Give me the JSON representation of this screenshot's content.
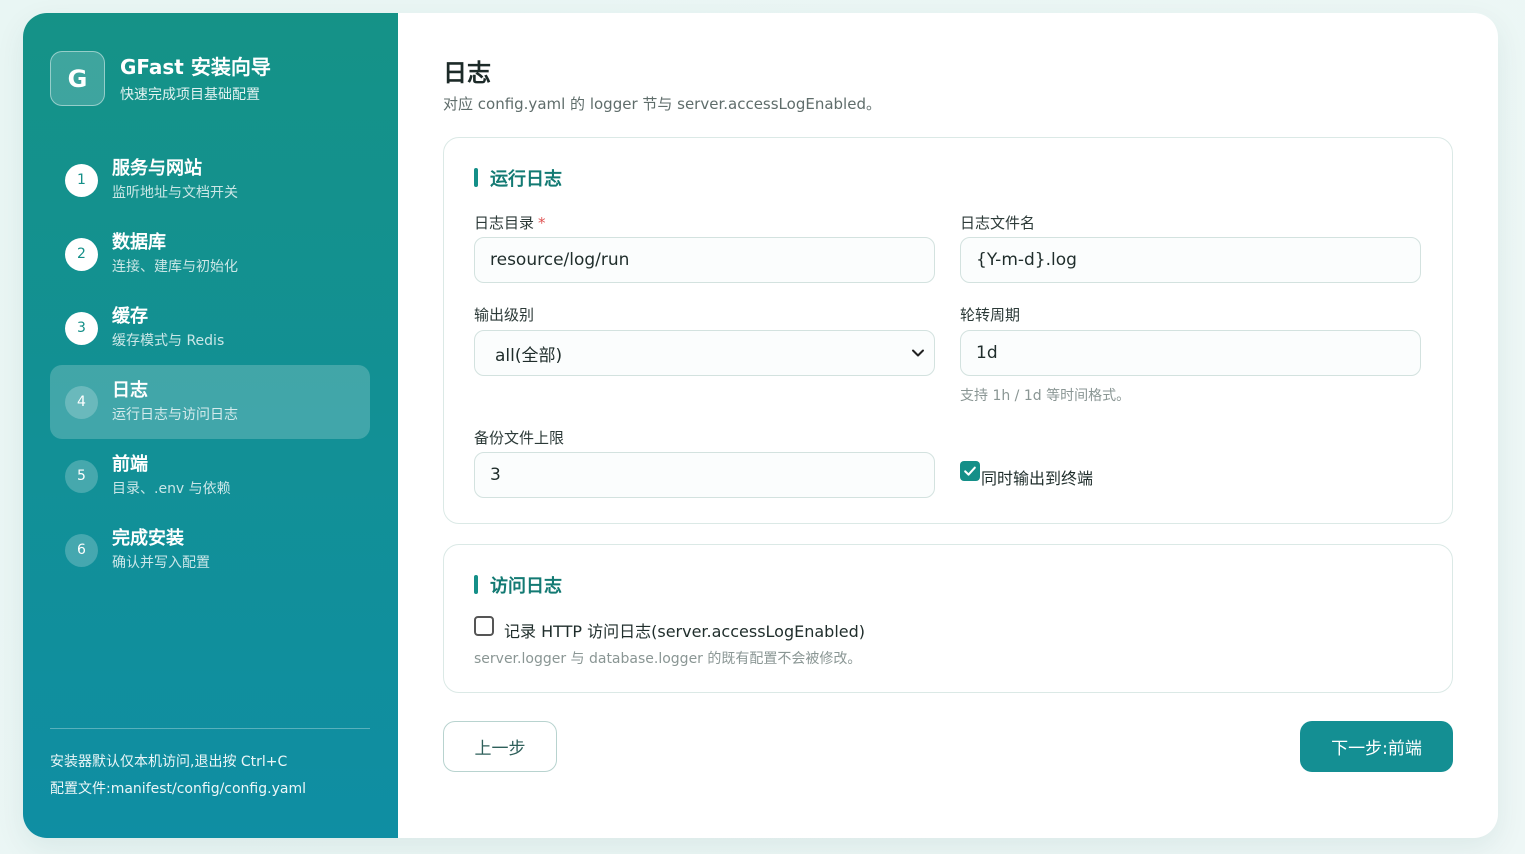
{
  "brand": {
    "logo_letter": "G",
    "title": "GFast 安装向导",
    "subtitle": "快速完成项目基础配置"
  },
  "steps": [
    {
      "num": "1",
      "title": "服务与网站",
      "desc": "监听地址与文档开关",
      "state": "done"
    },
    {
      "num": "2",
      "title": "数据库",
      "desc": "连接、建库与初始化",
      "state": "done"
    },
    {
      "num": "3",
      "title": "缓存",
      "desc": "缓存模式与 Redis",
      "state": "done"
    },
    {
      "num": "4",
      "title": "日志",
      "desc": "运行日志与访问日志",
      "state": "active"
    },
    {
      "num": "5",
      "title": "前端",
      "desc": "目录、.env 与依赖",
      "state": "todo"
    },
    {
      "num": "6",
      "title": "完成安装",
      "desc": "确认并写入配置",
      "state": "todo"
    }
  ],
  "footer": {
    "line1": "安装器默认仅本机访问,退出按 Ctrl+C",
    "line2": "配置文件:manifest/config/config.yaml"
  },
  "page": {
    "title": "日志",
    "subtitle": "对应 config.yaml 的 logger 节与 server.accessLogEnabled。"
  },
  "run_log": {
    "section_title": "运行日志",
    "dir_label": "日志目录",
    "dir_required": "*",
    "dir_value": "resource/log/run",
    "file_label": "日志文件名",
    "file_value": "{Y-m-d}.log",
    "level_label": "输出级别",
    "level_value": "all(全部)",
    "rotate_label": "轮转周期",
    "rotate_value": "1d",
    "rotate_hint": "支持 1h / 1d 等时间格式。",
    "backup_label": "备份文件上限",
    "backup_value": "3",
    "stdout_label": "同时输出到终端",
    "stdout_checked": true
  },
  "access_log": {
    "section_title": "访问日志",
    "enable_label": "记录 HTTP 访问日志(server.accessLogEnabled)",
    "enable_checked": false,
    "hint": "server.logger 与 database.logger 的既有配置不会被修改。"
  },
  "buttons": {
    "prev": "上一步",
    "next": "下一步:前端"
  },
  "colors": {
    "accent": "#148f88",
    "sidebar_top": "#159287",
    "sidebar_bottom": "#0f8ea3"
  }
}
